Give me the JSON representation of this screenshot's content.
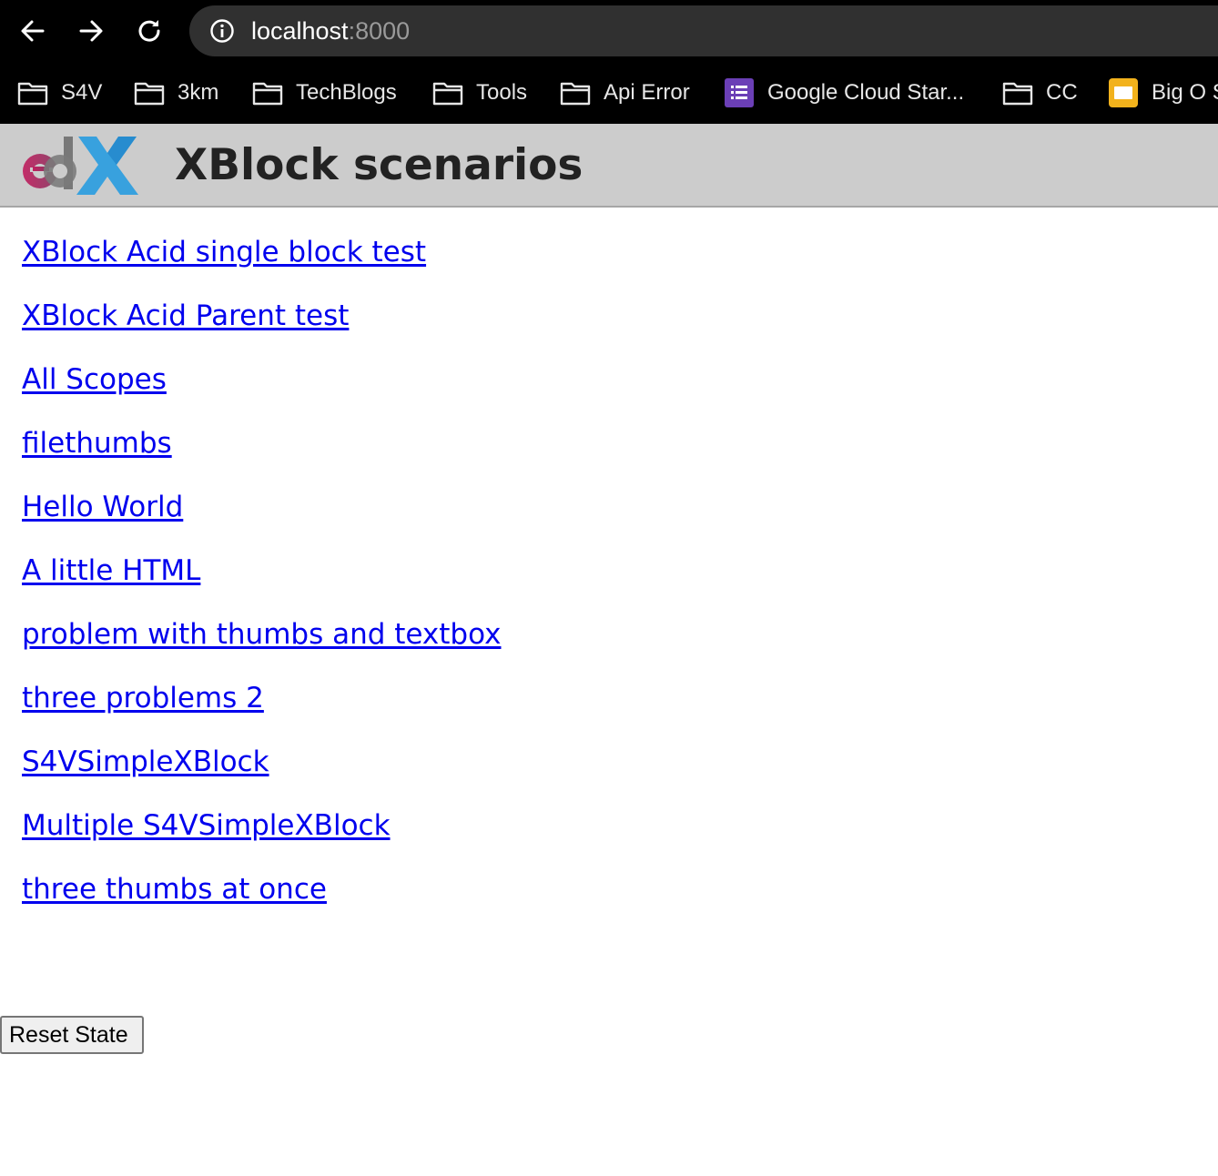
{
  "browser": {
    "url_host": "localhost",
    "url_port": ":8000",
    "bookmarks": [
      {
        "label": "S4V",
        "icon": "folder-icon"
      },
      {
        "label": "3km",
        "icon": "folder-icon"
      },
      {
        "label": "TechBlogs",
        "icon": "folder-icon"
      },
      {
        "label": "Tools",
        "icon": "folder-icon"
      },
      {
        "label": "Api Error",
        "icon": "folder-icon"
      },
      {
        "label": "Google Cloud Star...",
        "icon": "google-forms-icon"
      },
      {
        "label": "CC",
        "icon": "folder-icon"
      },
      {
        "label": "Big O S",
        "icon": "google-slides-icon"
      }
    ]
  },
  "header": {
    "logo": "edX",
    "title": "XBlock scenarios"
  },
  "scenarios": [
    "XBlock Acid single block test",
    "XBlock Acid Parent test",
    "All Scopes",
    "filethumbs",
    "Hello World",
    "A little HTML",
    "problem with thumbs and textbox",
    "three problems 2",
    "S4VSimpleXBlock",
    "Multiple S4VSimpleXBlock",
    "three thumbs at once"
  ],
  "reset_button_label": "Reset State",
  "colors": {
    "link": "#0000ee",
    "header_bg": "#cccccc",
    "browser_bg": "#000000",
    "address_bar_bg": "#303030",
    "edx_magenta": "#b7265f",
    "edx_gray": "#777777",
    "edx_blue": "#2a9ddf"
  }
}
